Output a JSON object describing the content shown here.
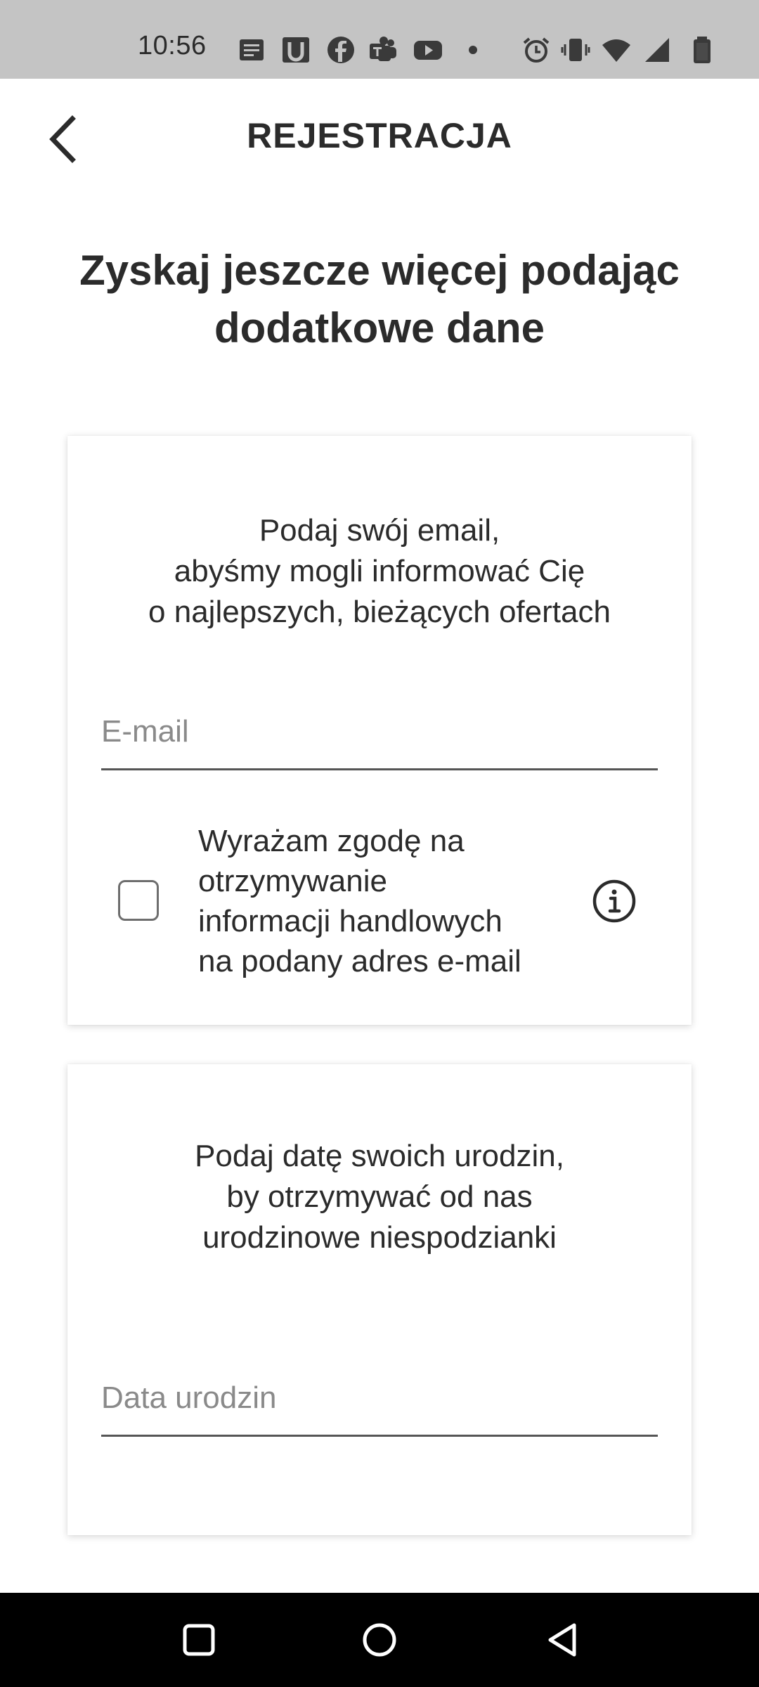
{
  "status_bar": {
    "time": "10:56",
    "icons": [
      "notes-icon",
      "u-app-icon",
      "facebook-icon",
      "teams-icon",
      "youtube-icon",
      "dot-icon",
      "alarm-icon",
      "vibrate-icon",
      "wifi-icon",
      "signal-icon",
      "battery-icon"
    ]
  },
  "header": {
    "back_icon": "chevron-left-icon",
    "title": "REJESTRACJA"
  },
  "headline": {
    "line1": "Zyskaj jeszcze więcej podając",
    "line2": "dodatkowe dane"
  },
  "email_card": {
    "text_line1": "Podaj swój email,",
    "text_line2": "abyśmy mogli informować Cię",
    "text_line3": "o najlepszych, bieżących ofertach",
    "email_placeholder": "E-mail",
    "email_value": "",
    "consent_line1": "Wyrażam zgodę na",
    "consent_line2": "otrzymywanie",
    "consent_line3": "informacji handlowych",
    "consent_line4": "na podany adres e-mail",
    "consent_checked": false,
    "info_icon": "info-icon"
  },
  "birthday_card": {
    "text_line1": "Podaj datę swoich urodzin,",
    "text_line2": "by otrzymywać od nas",
    "text_line3": "urodzinowe niespodzianki",
    "birthday_placeholder": "Data urodzin",
    "birthday_value": ""
  },
  "nav_bar": {
    "recents_icon": "square-recents-icon",
    "home_icon": "circle-home-icon",
    "back_icon": "triangle-back-icon"
  }
}
